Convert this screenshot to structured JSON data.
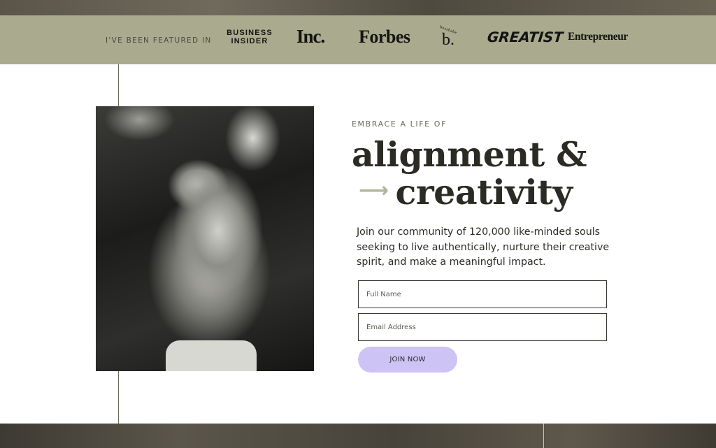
{
  "featured": {
    "label": "I'VE BEEN FEATURED IN",
    "logos": {
      "business_insider": "BUSINESS\nINSIDER",
      "inc": "Inc.",
      "forbes": "Forbes",
      "bossbabe_small": "bossbabe",
      "bossbabe_b": "b.",
      "greatist": "GREATIST",
      "entrepreneur": "Entrepreneur"
    }
  },
  "hero": {
    "eyebrow": "EMBRACE A LIFE OF",
    "headline_line1": "alignment &",
    "headline_arrow": "⟶",
    "headline_line2": "creativity",
    "description": "Join our community of 120,000 like-minded souls seeking to live authentically, nurture their creative spirit, and make a meaningful impact."
  },
  "form": {
    "full_name_placeholder": "Full Name",
    "email_placeholder": "Email Address",
    "submit_label": "JOIN NOW"
  },
  "colors": {
    "featured_bar": "#aaab8e",
    "button": "#cec3f5",
    "headline": "#2b2b24"
  }
}
